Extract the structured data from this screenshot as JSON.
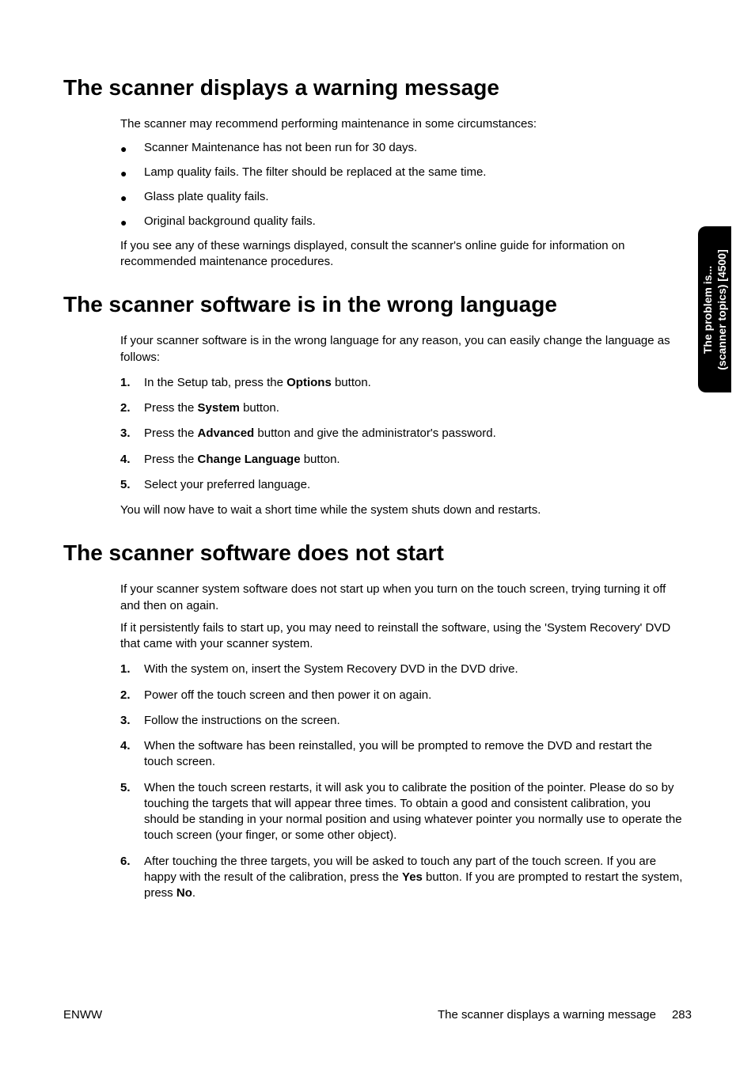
{
  "sidetab": {
    "line1": "The problem is...",
    "line2": "(scanner topics) [4500]"
  },
  "s1": {
    "heading": "The scanner displays a warning message",
    "intro": "The scanner may recommend performing maintenance in some circumstances:",
    "bullets": [
      "Scanner Maintenance has not been run for 30 days.",
      "Lamp quality fails. The filter should be replaced at the same time.",
      "Glass plate quality fails.",
      "Original background quality fails."
    ],
    "outro": "If you see any of these warnings displayed, consult the scanner's online guide for information on recommended maintenance procedures."
  },
  "s2": {
    "heading": "The scanner software is in the wrong language",
    "intro": "If your scanner software is in the wrong language for any reason, you can easily change the language as follows:",
    "steps": [
      {
        "pre": "In the Setup tab, press the ",
        "bold": "Options",
        "post": " button."
      },
      {
        "pre": "Press the ",
        "bold": "System",
        "post": " button."
      },
      {
        "pre": "Press the ",
        "bold": "Advanced",
        "post": " button and give the administrator's password."
      },
      {
        "pre": "Press the ",
        "bold": "Change Language",
        "post": " button."
      },
      {
        "pre": "Select your preferred language.",
        "bold": "",
        "post": ""
      }
    ],
    "outro": "You will now have to wait a short time while the system shuts down and restarts."
  },
  "s3": {
    "heading": "The scanner software does not start",
    "p1": "If your scanner system software does not start up when you turn on the touch screen, trying turning it off and then on again.",
    "p2": "If it persistently fails to start up, you may need to reinstall the software, using the 'System Recovery' DVD that came with your scanner system.",
    "step1": "With the system on, insert the System Recovery DVD in the DVD drive.",
    "step2": "Power off the touch screen and then power it on again.",
    "step3": "Follow the instructions on the screen.",
    "step4": "When the software has been reinstalled, you will be prompted to remove the DVD and restart the touch screen.",
    "step5": "When the touch screen restarts, it will ask you to calibrate the position of the pointer. Please do so by touching the targets that will appear three times. To obtain a good and consistent calibration, you should be standing in your normal position and using whatever pointer you normally use to operate the touch screen (your finger, or some other object).",
    "step6_pre": "After touching the three targets, you will be asked to touch any part of the touch screen. If you are happy with the result of the calibration, press the ",
    "step6_b1": "Yes",
    "step6_mid": " button. If you are prompted to restart the system, press ",
    "step6_b2": "No",
    "step6_post": "."
  },
  "footer": {
    "left": "ENWW",
    "right_text": "The scanner displays a warning message",
    "page": "283"
  }
}
